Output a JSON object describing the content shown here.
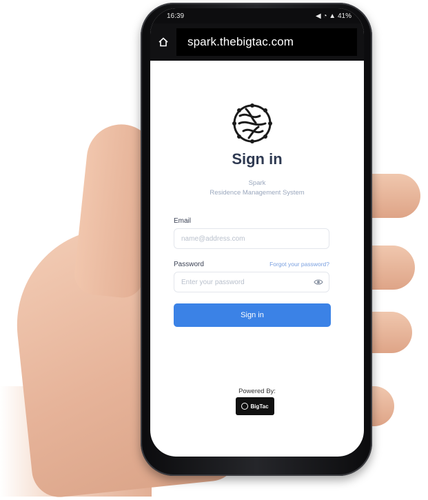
{
  "status_bar": {
    "time": "16:39",
    "right": "◀ ◔ ▲ 41%"
  },
  "browser": {
    "url": "spark.thebigtac.com"
  },
  "login": {
    "title": "Sign in",
    "subtitle_line1": "Spark",
    "subtitle_line2": "Residence Management System",
    "email_label": "Email",
    "email_placeholder": "name@address.com",
    "password_label": "Password",
    "forgot_link": "Forgot your password?",
    "password_placeholder": "Enter your password",
    "submit_label": "Sign in"
  },
  "footer": {
    "powered_by": "Powered By:",
    "brand": "BigTac"
  },
  "colors": {
    "accent": "#3b82e6",
    "title": "#2f3a52",
    "link": "#7aa0e0"
  },
  "icons": [
    "home-icon",
    "spark-logo-icon",
    "eye-icon",
    "bigtac-logo-icon"
  ]
}
